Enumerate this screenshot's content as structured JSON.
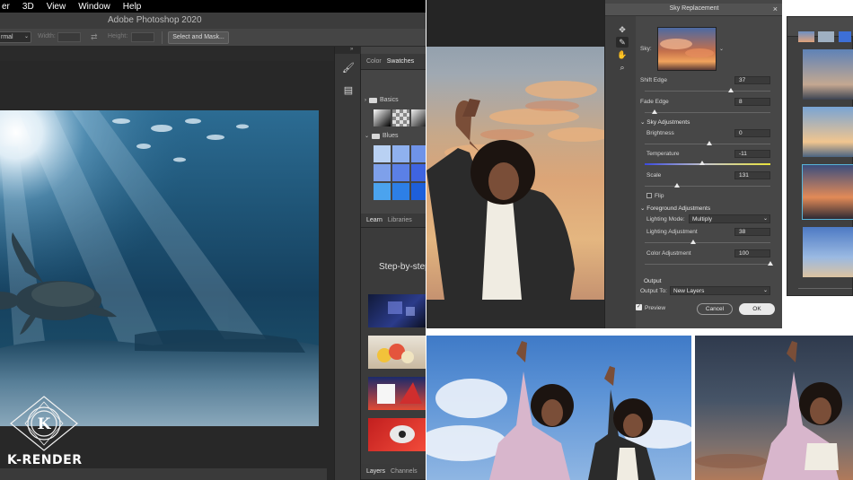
{
  "photoshop": {
    "menubar": [
      "er",
      "3D",
      "View",
      "Window",
      "Help"
    ],
    "window_title": "Adobe Photoshop 2020",
    "options_bar": {
      "mode_value": "rmal",
      "width_label": "Width:",
      "height_label": "Height:",
      "select_and_mask_label": "Select and Mask..."
    },
    "panels": {
      "color_tab": "Color",
      "swatches_tab": "Swatches",
      "groups": [
        "Basics",
        "Blues"
      ],
      "swatch_colors_blues": [
        "#b9d1f3",
        "#8fb1ef",
        "#6f93e8",
        "#7ea0ea",
        "#5b80e6",
        "#3f64e0",
        "#4ba3ee",
        "#2d7fe6",
        "#1e5fda"
      ],
      "learn_tab": "Learn",
      "libraries_tab": "Libraries",
      "learn_heading": "Step-by-step",
      "layers_tab": "Layers",
      "channels_tab": "Channels"
    },
    "tools": [
      "brush-icon",
      "layers-icon"
    ]
  },
  "sky_replacement": {
    "title": "Sky Replacement",
    "close_glyph": "×",
    "sky_label": "Sky:",
    "shift_edge": {
      "label": "Shift Edge",
      "value": "37"
    },
    "fade_edge": {
      "label": "Fade Edge",
      "value": "8"
    },
    "sky_adjustments": "Sky Adjustments",
    "brightness": {
      "label": "Brightness",
      "value": "0"
    },
    "temperature": {
      "label": "Temperature",
      "value": "-11"
    },
    "scale": {
      "label": "Scale",
      "value": "131"
    },
    "flip_label": "Flip",
    "foreground_adjustments": "Foreground Adjustments",
    "lighting_mode": {
      "label": "Lighting Mode:",
      "value": "Multiply"
    },
    "lighting_adjustment": {
      "label": "Lighting Adjustment",
      "value": "38"
    },
    "color_adjustment": {
      "label": "Color Adjustment",
      "value": "100"
    },
    "output_section": "Output",
    "output_to": {
      "label": "Output To:",
      "value": "New Layers"
    },
    "preview_label": "Preview",
    "cancel_label": "Cancel",
    "ok_label": "OK"
  },
  "watermark": {
    "letter": "K",
    "text": "K-RENDER"
  },
  "colors": {
    "ps_dark": "#2e2e2e",
    "dialog_bg": "#474747",
    "accent_blue": "#3f64e0"
  }
}
